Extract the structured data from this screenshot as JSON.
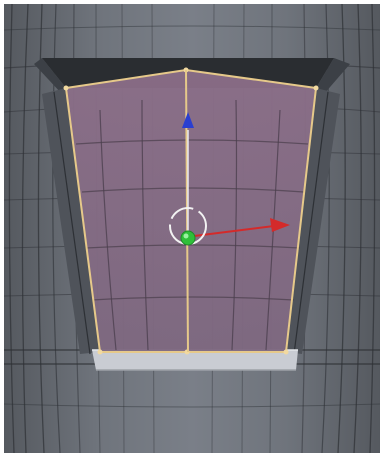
{
  "viewport": {
    "mode": "edit-mode",
    "colors": {
      "mesh_face": "#6b7078",
      "mesh_face_light": "#7c818a",
      "mesh_face_dark": "#4f535a",
      "wire": "#2d3035",
      "selected_face": "#8a6d86",
      "selected_edge": "#e6c98a",
      "selected_vertex": "#f2d9a0",
      "rim_dark": "#2a2d31",
      "rim_light": "#c9ccd3",
      "axis_x": "#d42a2a",
      "axis_y": "#2a3fd0",
      "axis_z_handle": "#2fbf3a",
      "rotate_ring": "#f2f2f2"
    },
    "selection": {
      "type": "face",
      "count": 1
    },
    "transform_gizmo": {
      "axes": [
        "x-axis-arrow",
        "y-axis-arrow"
      ],
      "center_handle": "green-center-handle",
      "rotate_ring": "rotation-ring"
    }
  }
}
